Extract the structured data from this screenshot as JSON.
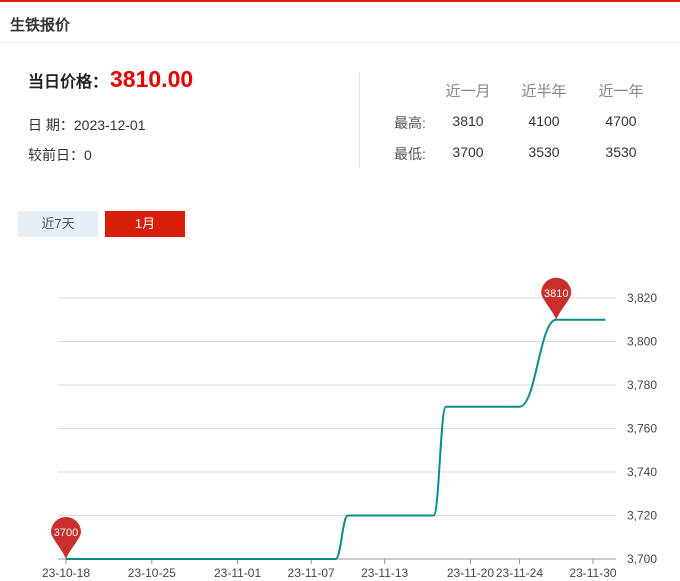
{
  "header": {
    "title": "生铁报价"
  },
  "today": {
    "price_label": "当日价格：",
    "price": "3810.00",
    "date_label": "日 期：",
    "date": "2023-12-01",
    "change_label": "较前日：",
    "change": "0"
  },
  "stats": {
    "headers": [
      "近一月",
      "近半年",
      "近一年"
    ],
    "rows": [
      {
        "label": "最高:",
        "values": [
          "3810",
          "4100",
          "4700"
        ]
      },
      {
        "label": "最低:",
        "values": [
          "3700",
          "3530",
          "3530"
        ]
      }
    ]
  },
  "tabs": [
    {
      "label": "近7天",
      "active": false
    },
    {
      "label": "1月",
      "active": true
    }
  ],
  "colors": {
    "accent": "#d81e06",
    "line": "#0e8c8c",
    "price": "#e60000",
    "marker": "#c9302c"
  },
  "chart_data": {
    "type": "line",
    "title": "",
    "xlabel": "",
    "ylabel": "",
    "ylim": [
      3700,
      3820
    ],
    "yticks": [
      3700,
      3720,
      3740,
      3760,
      3780,
      3800,
      3820
    ],
    "ytick_labels": [
      "3,700",
      "3,720",
      "3,740",
      "3,760",
      "3,780",
      "3,800",
      "3,820"
    ],
    "xtick_labels": [
      "23-10-18",
      "23-10-25",
      "23-11-01",
      "23-11-07",
      "23-11-13",
      "23-11-20",
      "23-11-24",
      "23-11-30"
    ],
    "grid": true,
    "series": [
      {
        "values": [
          [
            "23-10-18",
            3700
          ],
          [
            "23-10-25",
            3700
          ],
          [
            "23-11-01",
            3700
          ],
          [
            "23-11-07",
            3700
          ],
          [
            "23-11-09",
            3700
          ],
          [
            "23-11-10",
            3720
          ],
          [
            "23-11-13",
            3720
          ],
          [
            "23-11-16",
            3720
          ],
          [
            "23-11-17",
            3720
          ],
          [
            "23-11-18",
            3770
          ],
          [
            "23-11-20",
            3770
          ],
          [
            "23-11-22",
            3770
          ],
          [
            "23-11-24",
            3770
          ],
          [
            "23-11-27",
            3810
          ],
          [
            "23-11-30",
            3810
          ],
          [
            "23-12-01",
            3810
          ]
        ]
      }
    ],
    "annotations": [
      {
        "label": "3700",
        "x": "23-10-18",
        "y": 3700
      },
      {
        "label": "3810",
        "x": "23-11-27",
        "y": 3810
      }
    ]
  }
}
